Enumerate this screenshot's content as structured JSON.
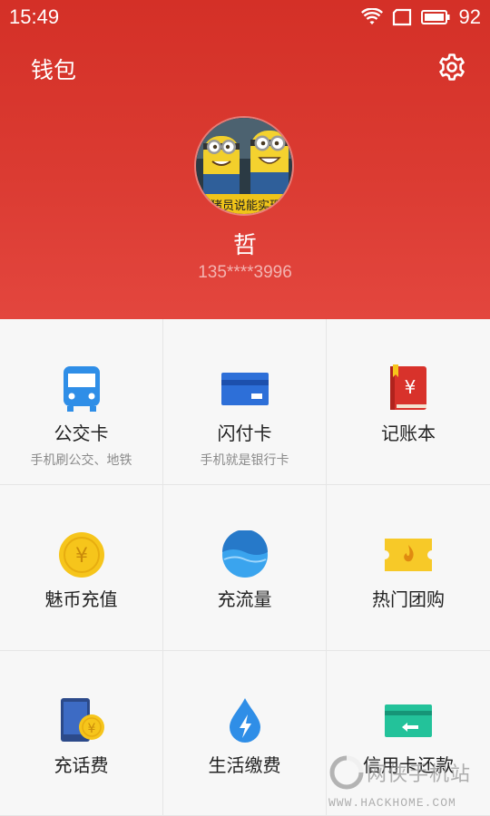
{
  "status": {
    "time": "15:49",
    "battery": "92"
  },
  "header": {
    "title": "钱包",
    "username": "哲",
    "phone": "135****3996",
    "avatar_caption": "猪员说能实现"
  },
  "grid": [
    {
      "label": "公交卡",
      "sub": "手机刷公交、地铁",
      "icon": "bus-icon"
    },
    {
      "label": "闪付卡",
      "sub": "手机就是银行卡",
      "icon": "bank-card-icon"
    },
    {
      "label": "记账本",
      "sub": "",
      "icon": "account-book-icon"
    },
    {
      "label": "魅币充值",
      "sub": "",
      "icon": "coin-icon"
    },
    {
      "label": "充流量",
      "sub": "",
      "icon": "data-traffic-icon"
    },
    {
      "label": "热门团购",
      "sub": "",
      "icon": "group-buy-ticket-icon"
    },
    {
      "label": "充话费",
      "sub": "",
      "icon": "phone-recharge-icon"
    },
    {
      "label": "生活缴费",
      "sub": "",
      "icon": "utility-bill-icon"
    },
    {
      "label": "信用卡还款",
      "sub": "",
      "icon": "credit-card-repay-icon"
    }
  ],
  "watermark": {
    "brand": "网侠手机站",
    "url": "WWW.HACKHOME.COM"
  },
  "colors": {
    "header_red": "#d43027",
    "bus_blue": "#2f8ee7",
    "card_blue": "#2d6fd8",
    "book_red": "#d8322b",
    "coin_yellow": "#f6c51b",
    "traffic_blue": "#3aa4ee",
    "ticket_yellow": "#f7c928",
    "green": "#23c29a"
  }
}
